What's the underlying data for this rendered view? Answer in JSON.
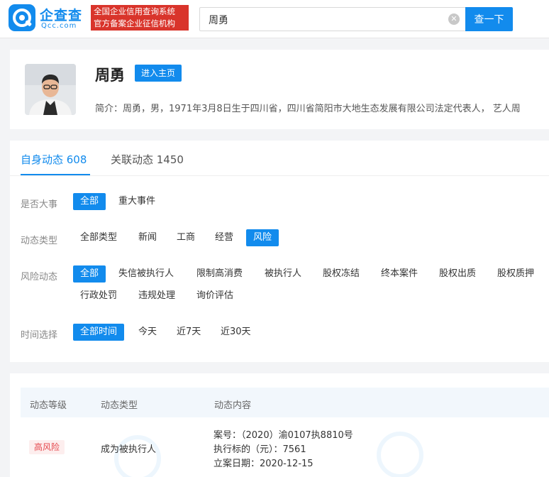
{
  "header": {
    "logo_text": "企查查",
    "logo_domain": "Qcc.com",
    "slogan_line1": "全国企业信用查询系统",
    "slogan_line2": "官方备案企业征信机构",
    "search_value": "周勇",
    "search_button": "查一下"
  },
  "profile": {
    "name": "周勇",
    "home_button": "进入主页",
    "bio": "简介：周勇，男，1971年3月8日生于四川省，四川省简阳市大地生态发展有限公司法定代表人， 艺人周"
  },
  "tabs": [
    {
      "label": "自身动态 608"
    },
    {
      "label": "关联动态 1450"
    }
  ],
  "filters": {
    "major": {
      "label": "是否大事",
      "options": [
        "全部",
        "重大事件"
      ]
    },
    "type": {
      "label": "动态类型",
      "options": [
        "全部类型",
        "新闻",
        "工商",
        "经营",
        "风险"
      ]
    },
    "risk": {
      "label": "风险动态",
      "options": [
        "全部",
        "失信被执行人",
        "限制高消费",
        "被执行人",
        "股权冻结",
        "终本案件",
        "股权出质",
        "股权质押",
        "行政处罚",
        "违规处理",
        "询价评估"
      ]
    },
    "time": {
      "label": "时间选择",
      "options": [
        "全部时间",
        "今天",
        "近7天",
        "近30天"
      ]
    }
  },
  "table": {
    "headers": [
      "动态等级",
      "动态类型",
      "动态内容"
    ],
    "rows": [
      {
        "level": "高风险",
        "type": "成为被执行人",
        "details": [
          "案号：（2020）渝0107执8810号",
          "执行标的（元）：7561",
          "立案日期：2020-12-15"
        ]
      }
    ]
  },
  "colors": {
    "brand": "#128bed",
    "risk": "#e5484d",
    "slogan_bg": "#d9342b"
  },
  "icons": {
    "logo": "qcc-logo-icon",
    "clear": "clear-icon"
  }
}
